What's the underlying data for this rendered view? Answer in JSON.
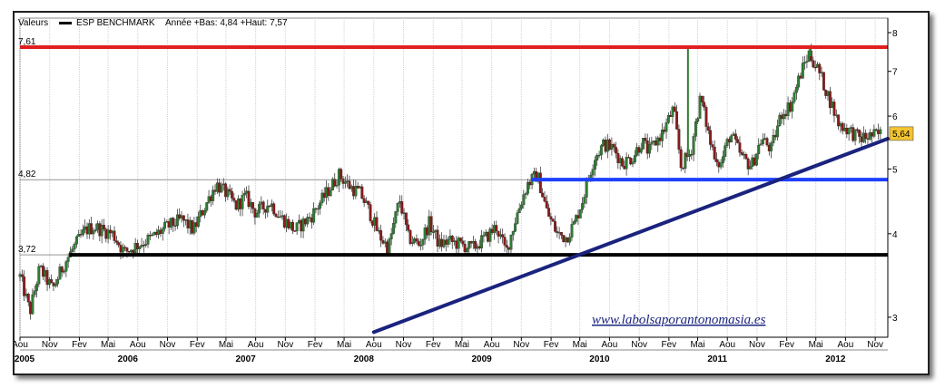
{
  "header": {
    "label": "Valeurs",
    "series_name": "ESP BENCHMARK",
    "stats": "Année +Bas: 4,84 +Haut: 7,57"
  },
  "watermark": "www.labolsaporantonomasia.es",
  "chart_data": {
    "type": "candlestick",
    "title": "",
    "ylim": [
      2.8,
      8.05
    ],
    "y_scale": "log",
    "y_ticks": [
      3,
      4,
      5,
      6,
      7,
      8
    ],
    "x_range": [
      "2005-08-01",
      "2012-12-10"
    ],
    "last_value": 5.64,
    "last_value_label": "5,64",
    "last_value_color": "#f4c430",
    "month_ticks": [
      {
        "date": "2005-08-01",
        "label": "Aou"
      },
      {
        "date": "2005-11-01",
        "label": "Nov"
      },
      {
        "date": "2006-02-01",
        "label": "Fev"
      },
      {
        "date": "2006-05-01",
        "label": "Mai"
      },
      {
        "date": "2006-08-01",
        "label": "Aou"
      },
      {
        "date": "2006-11-01",
        "label": "Nov"
      },
      {
        "date": "2007-02-01",
        "label": "Fev"
      },
      {
        "date": "2007-05-01",
        "label": "Mai"
      },
      {
        "date": "2007-08-01",
        "label": "Aou"
      },
      {
        "date": "2007-11-01",
        "label": "Nov"
      },
      {
        "date": "2008-02-01",
        "label": "Fev"
      },
      {
        "date": "2008-05-01",
        "label": "Mai"
      },
      {
        "date": "2008-08-01",
        "label": "Aou"
      },
      {
        "date": "2008-11-01",
        "label": "Nov"
      },
      {
        "date": "2009-02-01",
        "label": "Fev"
      },
      {
        "date": "2009-05-01",
        "label": "Mai"
      },
      {
        "date": "2009-08-01",
        "label": "Aou"
      },
      {
        "date": "2009-11-01",
        "label": "Nov"
      },
      {
        "date": "2010-02-01",
        "label": "Fev"
      },
      {
        "date": "2010-05-01",
        "label": "Mai"
      },
      {
        "date": "2010-08-01",
        "label": "Aou"
      },
      {
        "date": "2010-11-01",
        "label": "Nov"
      },
      {
        "date": "2011-02-01",
        "label": "Fev"
      },
      {
        "date": "2011-05-01",
        "label": "Mai"
      },
      {
        "date": "2011-08-01",
        "label": "Aou"
      },
      {
        "date": "2011-11-01",
        "label": "Nov"
      },
      {
        "date": "2012-02-01",
        "label": "Fev"
      },
      {
        "date": "2012-05-01",
        "label": "Mai"
      },
      {
        "date": "2012-08-01",
        "label": "Aou"
      },
      {
        "date": "2012-11-01",
        "label": "Nov"
      }
    ],
    "year_labels": [
      {
        "date": "2005-08-15",
        "label": "2005"
      },
      {
        "date": "2006-07-01",
        "label": "2006"
      },
      {
        "date": "2007-07-01",
        "label": "2007"
      },
      {
        "date": "2008-07-01",
        "label": "2008"
      },
      {
        "date": "2009-07-01",
        "label": "2009"
      },
      {
        "date": "2010-07-01",
        "label": "2010"
      },
      {
        "date": "2011-07-01",
        "label": "2011"
      },
      {
        "date": "2012-07-01",
        "label": "2012"
      }
    ],
    "levels": [
      {
        "name": "resistance",
        "value": 7.61,
        "label": "7,61",
        "color": "#e02020",
        "from": "2005-08-01",
        "to": "2012-12-10"
      },
      {
        "name": "support-mid",
        "value": 4.82,
        "label": "4,82",
        "color": "#1e40ff",
        "from": "2009-12-01",
        "to": "2012-12-10"
      },
      {
        "name": "support-low",
        "value": 3.72,
        "label": "3,72",
        "color": "#000000",
        "from": "2006-01-01",
        "to": "2012-12-10"
      }
    ],
    "trendline": {
      "color": "#1a237e",
      "start": {
        "date": "2008-08-01",
        "value": 2.85
      },
      "end": {
        "date": "2012-12-10",
        "value": 5.55
      }
    },
    "price_path": [
      [
        "2005-08-01",
        3.45
      ],
      [
        "2005-09-01",
        3.05
      ],
      [
        "2005-10-01",
        3.55
      ],
      [
        "2005-11-10",
        3.3
      ],
      [
        "2005-12-15",
        3.6
      ],
      [
        "2006-01-20",
        3.85
      ],
      [
        "2006-02-20",
        4.05
      ],
      [
        "2006-03-20",
        4.1
      ],
      [
        "2006-04-15",
        4.05
      ],
      [
        "2006-05-15",
        4.0
      ],
      [
        "2006-06-20",
        3.75
      ],
      [
        "2006-08-01",
        3.85
      ],
      [
        "2006-09-15",
        3.95
      ],
      [
        "2006-11-01",
        4.1
      ],
      [
        "2006-12-15",
        4.2
      ],
      [
        "2007-01-20",
        4.05
      ],
      [
        "2007-02-20",
        4.35
      ],
      [
        "2007-04-01",
        4.75
      ],
      [
        "2007-05-01",
        4.6
      ],
      [
        "2007-06-01",
        4.4
      ],
      [
        "2007-07-01",
        4.55
      ],
      [
        "2007-08-01",
        4.3
      ],
      [
        "2007-09-15",
        4.45
      ],
      [
        "2007-10-15",
        4.25
      ],
      [
        "2007-12-01",
        4.05
      ],
      [
        "2008-01-20",
        4.25
      ],
      [
        "2008-03-01",
        4.55
      ],
      [
        "2008-04-15",
        4.9
      ],
      [
        "2008-05-20",
        4.7
      ],
      [
        "2008-06-20",
        4.6
      ],
      [
        "2008-07-20",
        4.3
      ],
      [
        "2008-08-15",
        4.0
      ],
      [
        "2008-09-15",
        3.8
      ],
      [
        "2008-10-20",
        4.5
      ],
      [
        "2008-11-15",
        3.95
      ],
      [
        "2008-12-20",
        3.85
      ],
      [
        "2009-01-20",
        4.15
      ],
      [
        "2009-02-20",
        3.85
      ],
      [
        "2009-03-20",
        3.9
      ],
      [
        "2009-05-01",
        3.85
      ],
      [
        "2009-06-01",
        3.8
      ],
      [
        "2009-07-15",
        3.95
      ],
      [
        "2009-08-15",
        4.1
      ],
      [
        "2009-09-15",
        3.75
      ],
      [
        "2009-10-20",
        4.3
      ],
      [
        "2009-11-20",
        4.75
      ],
      [
        "2009-12-20",
        4.9
      ],
      [
        "2010-01-20",
        4.3
      ],
      [
        "2010-02-20",
        4.0
      ],
      [
        "2010-03-20",
        3.95
      ],
      [
        "2010-04-15",
        4.15
      ],
      [
        "2010-05-10",
        4.5
      ],
      [
        "2010-06-15",
        5.2
      ],
      [
        "2010-07-15",
        5.45
      ],
      [
        "2010-08-15",
        5.35
      ],
      [
        "2010-09-10",
        5.1
      ],
      [
        "2010-10-10",
        5.2
      ],
      [
        "2010-11-10",
        5.5
      ],
      [
        "2010-12-01",
        5.3
      ],
      [
        "2011-01-15",
        5.7
      ],
      [
        "2011-02-15",
        6.15
      ],
      [
        "2011-03-10",
        5.05
      ],
      [
        "2011-04-10",
        5.3
      ],
      [
        "2011-05-10",
        6.4
      ],
      [
        "2011-06-10",
        5.45
      ],
      [
        "2011-07-10",
        5.05
      ],
      [
        "2011-08-10",
        5.65
      ],
      [
        "2011-09-15",
        5.2
      ],
      [
        "2011-10-15",
        5.05
      ],
      [
        "2011-11-15",
        5.55
      ],
      [
        "2011-12-15",
        5.35
      ],
      [
        "2012-01-15",
        6.05
      ],
      [
        "2012-02-15",
        6.25
      ],
      [
        "2012-03-15",
        6.95
      ],
      [
        "2012-04-10",
        7.45
      ],
      [
        "2012-05-10",
        7.0
      ],
      [
        "2012-06-10",
        6.4
      ],
      [
        "2012-07-10",
        5.85
      ],
      [
        "2012-08-15",
        5.7
      ],
      [
        "2012-09-15",
        5.55
      ],
      [
        "2012-10-15",
        5.6
      ],
      [
        "2012-11-20",
        5.64
      ]
    ],
    "spikes": [
      {
        "date": "2011-04-01",
        "value": 7.57
      },
      {
        "date": "2012-04-15",
        "value": 7.6
      }
    ]
  }
}
